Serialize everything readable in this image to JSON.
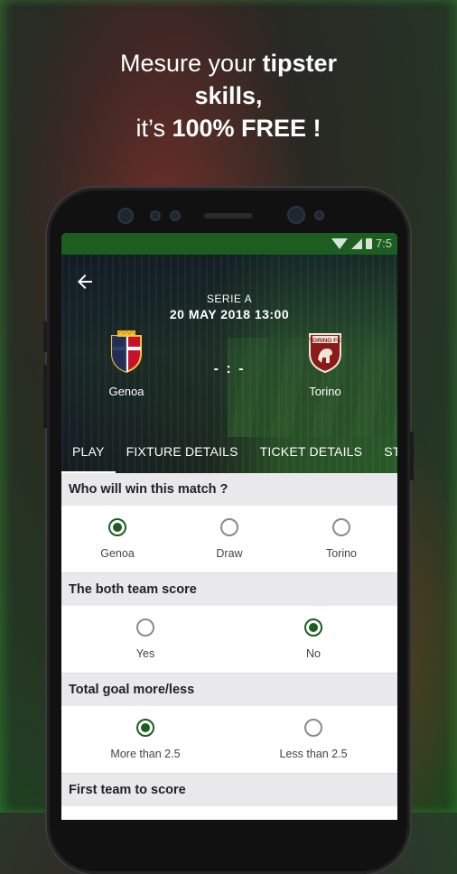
{
  "promo": {
    "line1_pre": "Mesure your ",
    "line1_bold": "tipster",
    "line2_bold": "skills,",
    "line3_pre": "it’s ",
    "line3_bold": "100% FREE !"
  },
  "status_bar": {
    "time": "7:5"
  },
  "match": {
    "competition": "SERIE A",
    "datetime": "20 MAY 2018 13:00",
    "home_team": "Genoa",
    "away_team": "Torino",
    "score": "- : -",
    "away_crest_text": "TORINO FC"
  },
  "tabs": [
    {
      "label": "PLAY",
      "active": true
    },
    {
      "label": "FIXTURE DETAILS",
      "active": false
    },
    {
      "label": "TICKET DETAILS",
      "active": false
    },
    {
      "label": "ST",
      "active": false
    }
  ],
  "questions": [
    {
      "title": "Who will win this match ?",
      "options": [
        "Genoa",
        "Draw",
        "Torino"
      ],
      "selected": 0
    },
    {
      "title": "The both team score",
      "options": [
        "Yes",
        "No"
      ],
      "selected": 1
    },
    {
      "title": "Total goal more/less",
      "options": [
        "More than 2.5",
        "Less than 2.5"
      ],
      "selected": 0
    },
    {
      "title": "First team to score",
      "options": [],
      "selected": null
    }
  ],
  "colors": {
    "accent": "#1b5e20",
    "status_bar": "#1b5e20",
    "background_panel": "#e9e9ec"
  },
  "icons": {
    "back": "arrow-left-icon",
    "wifi": "wifi-icon",
    "signal": "signal-icon",
    "battery": "battery-icon"
  }
}
